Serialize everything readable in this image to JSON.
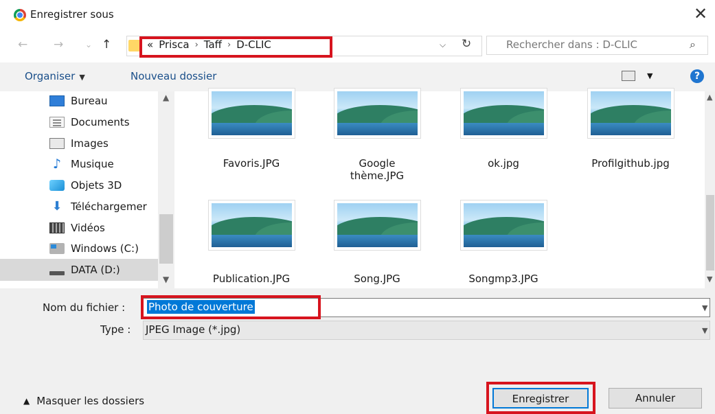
{
  "window": {
    "title": "Enregistrer sous",
    "close_glyph": "✕"
  },
  "nav": {
    "back": "←",
    "forward": "→",
    "recent": "⌄",
    "up": "↑",
    "breadcrumb": {
      "prefix": "«",
      "items": [
        "Prisca",
        "Taff",
        "D-CLIC"
      ],
      "separator": "›"
    },
    "refresh": "↻",
    "search_placeholder": "Rechercher dans : D-CLIC"
  },
  "toolbar": {
    "organize": "Organiser",
    "new_folder": "Nouveau dossier",
    "help": "?"
  },
  "sidebar": {
    "items": [
      {
        "label": "Bureau",
        "icon": "desktop-icon"
      },
      {
        "label": "Documents",
        "icon": "documents-icon"
      },
      {
        "label": "Images",
        "icon": "pictures-icon"
      },
      {
        "label": "Musique",
        "icon": "music-icon"
      },
      {
        "label": "Objets 3D",
        "icon": "3d-objects-icon"
      },
      {
        "label": "Téléchargemer",
        "icon": "downloads-icon"
      },
      {
        "label": "Vidéos",
        "icon": "videos-icon"
      },
      {
        "label": "Windows (C:)",
        "icon": "drive-c-icon"
      },
      {
        "label": "DATA (D:)",
        "icon": "drive-d-icon",
        "selected": true
      }
    ]
  },
  "files": [
    {
      "name": "Favoris.JPG"
    },
    {
      "name": "Google\nthème.JPG"
    },
    {
      "name": "ok.jpg"
    },
    {
      "name": "Profilgithub.jpg"
    },
    {
      "name": "Publication.JPG"
    },
    {
      "name": "Song.JPG"
    },
    {
      "name": "Songmp3.JPG"
    }
  ],
  "form": {
    "filename_label": "Nom du fichier :",
    "filename_value": "Photo de couverture",
    "type_label": "Type :",
    "type_value": "JPEG Image (*.jpg)"
  },
  "footer": {
    "hide_folders": "Masquer les dossiers",
    "save": "Enregistrer",
    "cancel": "Annuler"
  },
  "colors": {
    "highlight_box": "#d7141e",
    "selection": "#0078d7",
    "link": "#1a4f8a"
  }
}
